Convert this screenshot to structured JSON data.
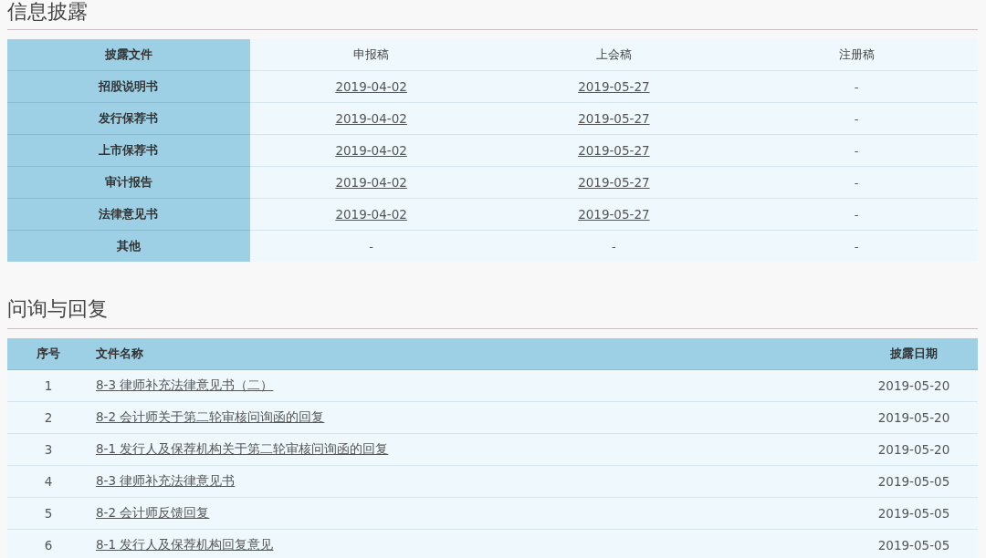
{
  "disclosure": {
    "title": "信息披露",
    "columns": [
      "披露文件",
      "申报稿",
      "上会稿",
      "注册稿"
    ],
    "rows": [
      {
        "cells": [
          {
            "kind": "header",
            "text": "招股说明书"
          },
          {
            "kind": "link",
            "text": "2019-04-02"
          },
          {
            "kind": "link",
            "text": "2019-05-27"
          },
          {
            "kind": "text",
            "text": "-"
          }
        ]
      },
      {
        "cells": [
          {
            "kind": "header",
            "text": "发行保荐书"
          },
          {
            "kind": "link",
            "text": "2019-04-02"
          },
          {
            "kind": "link",
            "text": "2019-05-27"
          },
          {
            "kind": "text",
            "text": "-"
          }
        ]
      },
      {
        "cells": [
          {
            "kind": "header",
            "text": "上市保荐书"
          },
          {
            "kind": "link",
            "text": "2019-04-02"
          },
          {
            "kind": "link",
            "text": "2019-05-27"
          },
          {
            "kind": "text",
            "text": "-"
          }
        ]
      },
      {
        "cells": [
          {
            "kind": "header",
            "text": "审计报告"
          },
          {
            "kind": "link",
            "text": "2019-04-02"
          },
          {
            "kind": "link",
            "text": "2019-05-27"
          },
          {
            "kind": "text",
            "text": "-"
          }
        ]
      },
      {
        "cells": [
          {
            "kind": "header",
            "text": "法律意见书"
          },
          {
            "kind": "link",
            "text": "2019-04-02"
          },
          {
            "kind": "link",
            "text": "2019-05-27"
          },
          {
            "kind": "text",
            "text": "-"
          }
        ]
      },
      {
        "cells": [
          {
            "kind": "header",
            "text": "其他"
          },
          {
            "kind": "text",
            "text": "-"
          },
          {
            "kind": "text",
            "text": "-"
          },
          {
            "kind": "text",
            "text": "-"
          }
        ]
      }
    ]
  },
  "inquiry": {
    "title": "问询与回复",
    "columns": [
      "序号",
      "文件名称",
      "披露日期"
    ],
    "rows": [
      {
        "index": "1",
        "name": "8-3 律师补充法律意见书（二）",
        "date": "2019-05-20"
      },
      {
        "index": "2",
        "name": "8-2 会计师关于第二轮审核问询函的回复",
        "date": "2019-05-20"
      },
      {
        "index": "3",
        "name": "8-1 发行人及保荐机构关于第二轮审核问询函的回复",
        "date": "2019-05-20"
      },
      {
        "index": "4",
        "name": "8-3 律师补充法律意见书",
        "date": "2019-05-05"
      },
      {
        "index": "5",
        "name": "8-2 会计师反馈回复",
        "date": "2019-05-05"
      },
      {
        "index": "6",
        "name": "8-1 发行人及保荐机构回复意见",
        "date": "2019-05-05"
      }
    ]
  }
}
